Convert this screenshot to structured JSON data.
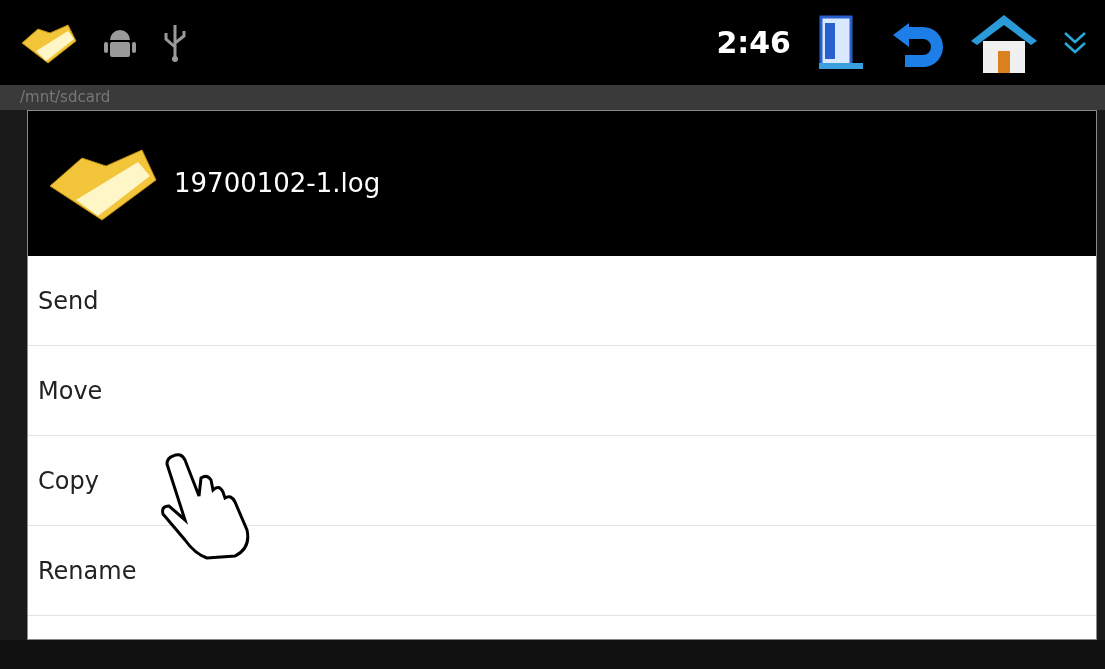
{
  "status_bar": {
    "time": "2:46"
  },
  "path_bar": {
    "path": "/mnt/sdcard"
  },
  "dialog": {
    "title": "19700102-1.log",
    "items": [
      {
        "label": "Send"
      },
      {
        "label": "Move"
      },
      {
        "label": "Copy"
      },
      {
        "label": "Rename"
      }
    ]
  }
}
